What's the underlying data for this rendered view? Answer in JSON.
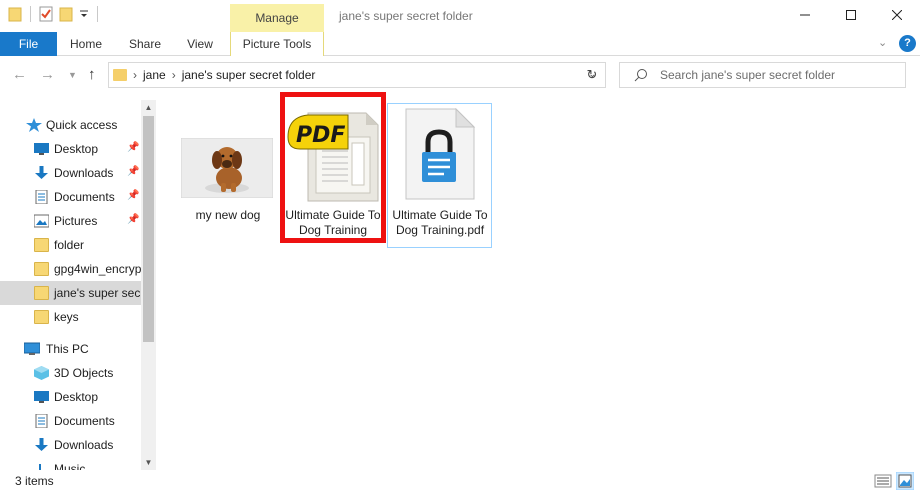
{
  "window": {
    "title": "jane's super secret folder",
    "manage_tab": "Manage"
  },
  "ribbon": {
    "file": "File",
    "tabs": [
      "Home",
      "Share",
      "View",
      "Picture Tools"
    ]
  },
  "address": {
    "crumbs": [
      "jane",
      "jane's super secret folder"
    ]
  },
  "search": {
    "placeholder": "Search jane's super secret folder"
  },
  "nav": {
    "quick_access": "Quick access",
    "quick_items": [
      {
        "label": "Desktop",
        "icon": "desktop-icon",
        "pinned": true
      },
      {
        "label": "Downloads",
        "icon": "download-arrow-icon",
        "pinned": true
      },
      {
        "label": "Documents",
        "icon": "document-icon",
        "pinned": true
      },
      {
        "label": "Pictures",
        "icon": "pictures-icon",
        "pinned": true
      },
      {
        "label": "folder",
        "icon": "folder-icon",
        "pinned": false
      },
      {
        "label": "gpg4win_encryp",
        "icon": "folder-icon",
        "pinned": false
      },
      {
        "label": "jane's super secr",
        "icon": "folder-icon",
        "pinned": false,
        "selected": true
      },
      {
        "label": "keys",
        "icon": "folder-icon",
        "pinned": false
      }
    ],
    "this_pc": "This PC",
    "pc_items": [
      {
        "label": "3D Objects",
        "icon": "3d-objects-icon"
      },
      {
        "label": "Desktop",
        "icon": "desktop-icon"
      },
      {
        "label": "Documents",
        "icon": "document-icon"
      },
      {
        "label": "Downloads",
        "icon": "download-arrow-icon"
      },
      {
        "label": "Music",
        "icon": "music-icon"
      }
    ]
  },
  "files": [
    {
      "name": "my new dog",
      "type": "image",
      "icon": "puppy-thumbnail"
    },
    {
      "name": "Ultimate Guide To Dog Training",
      "type": "pdf",
      "icon": "pdf-document-icon",
      "highlighted": true
    },
    {
      "name": "Ultimate Guide To Dog Training.pdf",
      "type": "encrypted-file",
      "icon": "locked-document-icon",
      "selected": true
    }
  ],
  "status": {
    "item_count": "3 items"
  },
  "colors": {
    "accent": "#1979ca",
    "manage_tab": "#f9f1a8",
    "highlight": "#ee1111",
    "pdf_yellow": "#f5d20a"
  }
}
